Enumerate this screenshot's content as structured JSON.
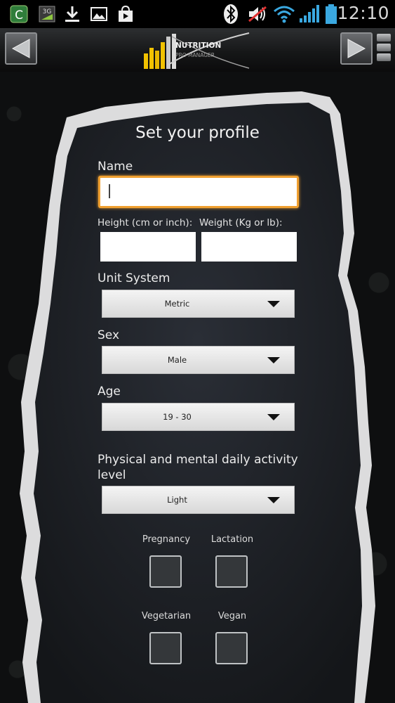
{
  "status_bar": {
    "time": "12:10",
    "network_label": "3G",
    "icons": [
      "app-c-icon",
      "network-3g-icon",
      "download-icon",
      "image-icon",
      "play-store-icon",
      "bluetooth-icon",
      "mute-icon",
      "wifi-icon",
      "signal-icon",
      "battery-icon"
    ]
  },
  "action_bar": {
    "logo_text_line1": "NUTRITION",
    "logo_text_line2": "PRO MANAGER",
    "icons": [
      "back-arrow-icon",
      "forward-arrow-icon",
      "overflow-menu-icon"
    ]
  },
  "form": {
    "title": "Set your profile",
    "name_label": "Name",
    "name_value": "",
    "height_label": "Height (cm or inch):",
    "height_value": "",
    "weight_label": "Weight (Kg or lb):",
    "weight_value": "",
    "unit_label": "Unit System",
    "unit_value": "Metric",
    "sex_label": "Sex",
    "sex_value": "Male",
    "age_label": "Age",
    "age_value": "19 - 30",
    "activity_label": "Physical and mental daily activity level",
    "activity_value": "Light",
    "checkboxes": {
      "pregnancy": "Pregnancy",
      "lactation": "Lactation",
      "vegetarian": "Vegetarian",
      "vegan": "Vegan"
    }
  },
  "colors": {
    "focus_accent": "#f0a030",
    "panel_bg": "#1e2127",
    "panel_edge": "#d9dadb",
    "logo_bars": "#f2c200"
  }
}
